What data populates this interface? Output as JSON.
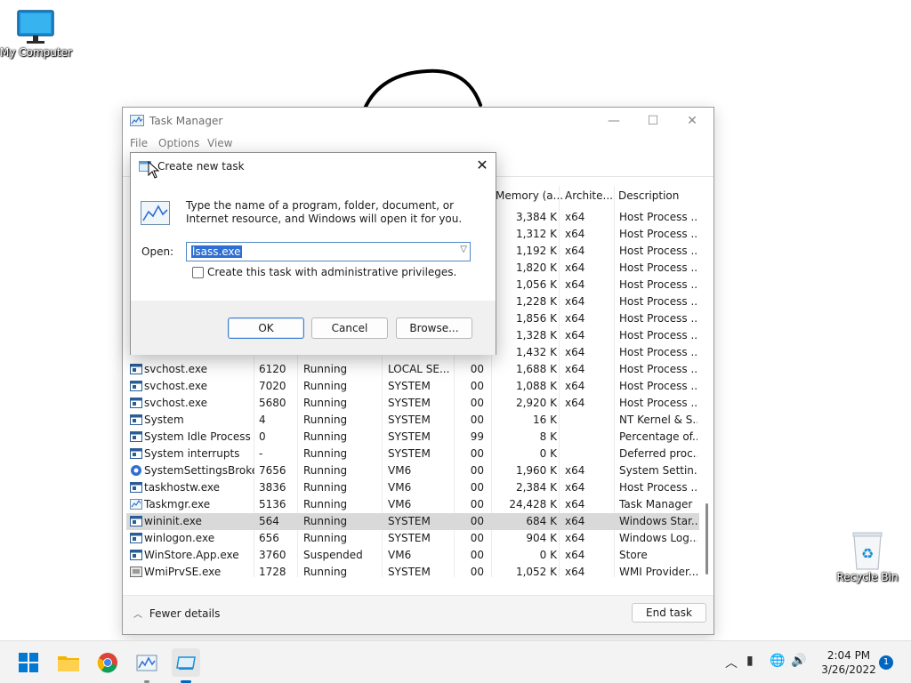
{
  "desktop": {
    "my_computer_label": "My Computer",
    "recycle_bin_label": "Recycle Bin"
  },
  "task_manager": {
    "title": "Task Manager",
    "menu": [
      "File",
      "Options",
      "View"
    ],
    "columns": {
      "memory": "Memory (a...",
      "architecture": "Archite...",
      "description": "Description"
    },
    "rows": [
      {
        "name": "",
        "pid": "",
        "status": "",
        "user": "",
        "cpu": "",
        "memory": "3,384 K",
        "arch": "x64",
        "desc": "Host Process ...",
        "icon": "process-icon"
      },
      {
        "name": "",
        "pid": "",
        "status": "",
        "user": "",
        "cpu": "",
        "memory": "1,312 K",
        "arch": "x64",
        "desc": "Host Process ...",
        "icon": "process-icon"
      },
      {
        "name": "",
        "pid": "",
        "status": "",
        "user": "",
        "cpu": "",
        "memory": "1,192 K",
        "arch": "x64",
        "desc": "Host Process ...",
        "icon": "process-icon"
      },
      {
        "name": "",
        "pid": "",
        "status": "",
        "user": "",
        "cpu": "",
        "memory": "1,820 K",
        "arch": "x64",
        "desc": "Host Process ...",
        "icon": "process-icon"
      },
      {
        "name": "",
        "pid": "",
        "status": "",
        "user": "",
        "cpu": "",
        "memory": "1,056 K",
        "arch": "x64",
        "desc": "Host Process ...",
        "icon": "process-icon"
      },
      {
        "name": "",
        "pid": "",
        "status": "",
        "user": "",
        "cpu": "",
        "memory": "1,228 K",
        "arch": "x64",
        "desc": "Host Process ...",
        "icon": "process-icon"
      },
      {
        "name": "",
        "pid": "",
        "status": "",
        "user": "",
        "cpu": "",
        "memory": "1,856 K",
        "arch": "x64",
        "desc": "Host Process ...",
        "icon": "process-icon"
      },
      {
        "name": "",
        "pid": "",
        "status": "",
        "user": "",
        "cpu": "",
        "memory": "1,328 K",
        "arch": "x64",
        "desc": "Host Process ...",
        "icon": "process-icon"
      },
      {
        "name": "",
        "pid": "",
        "status": "",
        "user": "",
        "cpu": "",
        "memory": "1,432 K",
        "arch": "x64",
        "desc": "Host Process ...",
        "icon": "process-icon"
      },
      {
        "name": "svchost.exe",
        "pid": "6120",
        "status": "Running",
        "user": "LOCAL SE...",
        "cpu": "00",
        "memory": "1,688 K",
        "arch": "x64",
        "desc": "Host Process ...",
        "icon": "process-icon"
      },
      {
        "name": "svchost.exe",
        "pid": "7020",
        "status": "Running",
        "user": "SYSTEM",
        "cpu": "00",
        "memory": "1,088 K",
        "arch": "x64",
        "desc": "Host Process ...",
        "icon": "process-icon"
      },
      {
        "name": "svchost.exe",
        "pid": "5680",
        "status": "Running",
        "user": "SYSTEM",
        "cpu": "00",
        "memory": "2,920 K",
        "arch": "x64",
        "desc": "Host Process ...",
        "icon": "process-icon"
      },
      {
        "name": "System",
        "pid": "4",
        "status": "Running",
        "user": "SYSTEM",
        "cpu": "00",
        "memory": "16 K",
        "arch": "",
        "desc": "NT Kernel & S...",
        "icon": "process-icon"
      },
      {
        "name": "System Idle Process",
        "pid": "0",
        "status": "Running",
        "user": "SYSTEM",
        "cpu": "99",
        "memory": "8 K",
        "arch": "",
        "desc": "Percentage of...",
        "icon": "process-icon"
      },
      {
        "name": "System interrupts",
        "pid": "-",
        "status": "Running",
        "user": "SYSTEM",
        "cpu": "00",
        "memory": "0 K",
        "arch": "",
        "desc": "Deferred proc...",
        "icon": "process-icon"
      },
      {
        "name": "SystemSettingsBroke...",
        "pid": "7656",
        "status": "Running",
        "user": "VM6",
        "cpu": "00",
        "memory": "1,960 K",
        "arch": "x64",
        "desc": "System Settin...",
        "icon": "settings-gear-icon"
      },
      {
        "name": "taskhostw.exe",
        "pid": "3836",
        "status": "Running",
        "user": "VM6",
        "cpu": "00",
        "memory": "2,384 K",
        "arch": "x64",
        "desc": "Host Process ...",
        "icon": "process-icon"
      },
      {
        "name": "Taskmgr.exe",
        "pid": "5136",
        "status": "Running",
        "user": "VM6",
        "cpu": "00",
        "memory": "24,428 K",
        "arch": "x64",
        "desc": "Task Manager",
        "icon": "task-manager-icon"
      },
      {
        "name": "wininit.exe",
        "pid": "564",
        "status": "Running",
        "user": "SYSTEM",
        "cpu": "00",
        "memory": "684 K",
        "arch": "x64",
        "desc": "Windows Star...",
        "icon": "process-icon",
        "selected": true
      },
      {
        "name": "winlogon.exe",
        "pid": "656",
        "status": "Running",
        "user": "SYSTEM",
        "cpu": "00",
        "memory": "904 K",
        "arch": "x64",
        "desc": "Windows Log...",
        "icon": "process-icon"
      },
      {
        "name": "WinStore.App.exe",
        "pid": "3760",
        "status": "Suspended",
        "user": "VM6",
        "cpu": "00",
        "memory": "0 K",
        "arch": "x64",
        "desc": "Store",
        "icon": "process-icon"
      },
      {
        "name": "WmiPrvSE.exe",
        "pid": "1728",
        "status": "Running",
        "user": "SYSTEM",
        "cpu": "00",
        "memory": "1,052 K",
        "arch": "x64",
        "desc": "WMI Provider...",
        "icon": "wmi-icon"
      }
    ],
    "fewer_details": "Fewer details",
    "end_task": "End task"
  },
  "run_dialog": {
    "title": "Create new task",
    "description": "Type the name of a program, folder, document, or Internet resource, and Windows will open it for you.",
    "open_label": "Open:",
    "open_value": "lsass.exe",
    "admin_checkbox_label": "Create this task with administrative privileges.",
    "admin_checked": false,
    "ok": "OK",
    "cancel": "Cancel",
    "browse": "Browse..."
  },
  "taskbar": {
    "apps": [
      "start-icon",
      "file-explorer-icon",
      "chrome-icon",
      "task-manager-icon",
      "run-dialog-icon"
    ],
    "time": "2:04 PM",
    "date": "3/26/2022",
    "notification_count": "1"
  },
  "colors": {
    "accent": "#0067c0",
    "selection": "#2f6fd1",
    "selected_row": "#d9d9d9"
  }
}
